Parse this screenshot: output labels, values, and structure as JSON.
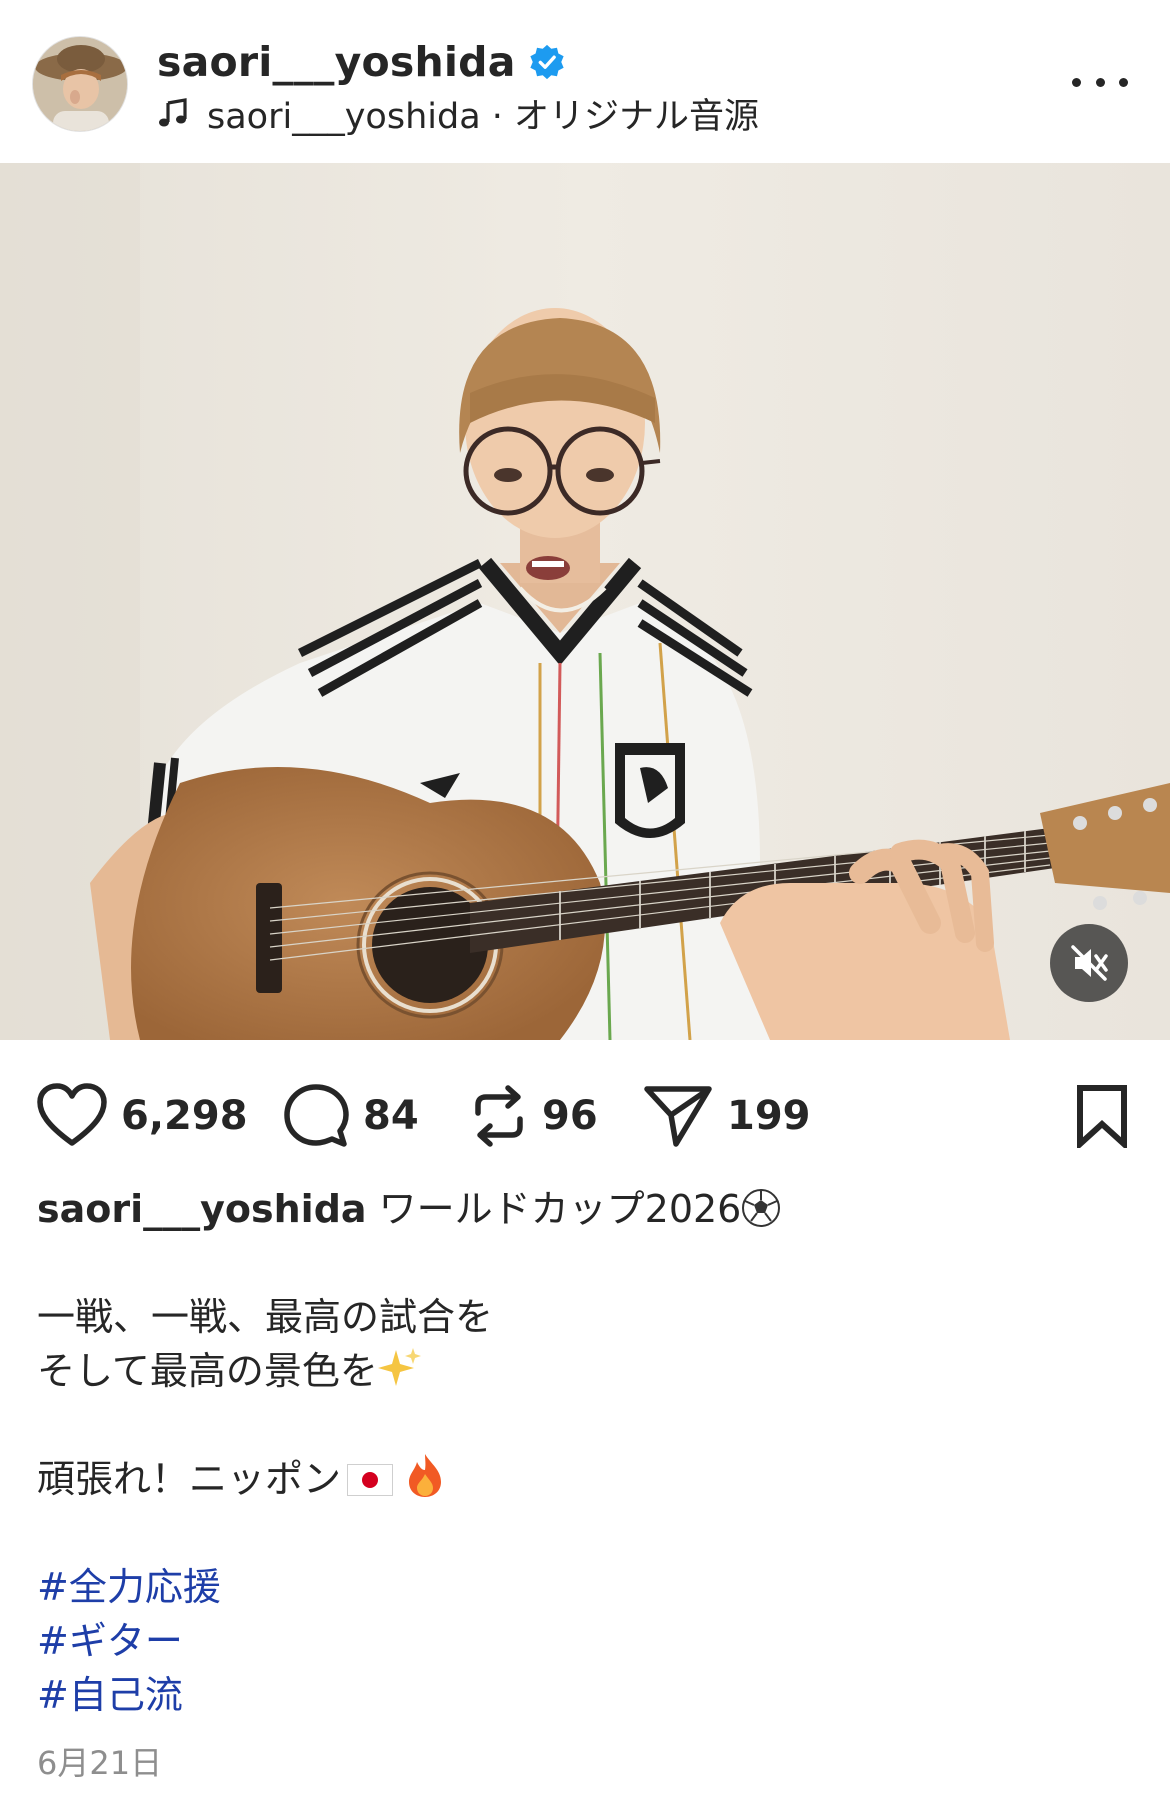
{
  "header": {
    "username": "saori___yoshida",
    "audio": "saori___yoshida · オリジナル音源"
  },
  "actions": {
    "likes": "6,298",
    "comments": "84",
    "reposts": "96",
    "shares": "199"
  },
  "caption": {
    "username": "saori___yoshida",
    "title": "ワールドカップ2026",
    "line1": "一戦、一戦、最高の試合を",
    "line2": "そして最高の景色を",
    "line3": "頑張れ！ニッポン",
    "hashtags": [
      "#全力応援",
      "#ギター",
      "#自己流"
    ]
  },
  "date": "6月21日",
  "colors": {
    "verified": "#1d9bf0",
    "hashtag": "#1e3ea8",
    "text": "#262626",
    "muted": "#8e8e8e"
  },
  "icons": [
    "verified-icon",
    "music-note-icon",
    "more-icon",
    "heart-icon",
    "comment-icon",
    "repost-icon",
    "share-icon",
    "bookmark-icon",
    "mute-icon"
  ]
}
